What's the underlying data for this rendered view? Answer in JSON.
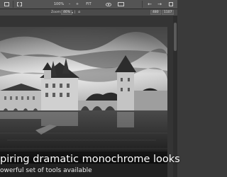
{
  "toolbar": {
    "icons": [
      "image-icon",
      "frame-icon",
      "zoom-out-icon",
      "zoom-in-icon",
      "fit-icon",
      "eye-icon",
      "compare-icon",
      "undo-icon",
      "redo-icon"
    ],
    "zoom_percent": "100%",
    "fit_label": "FIT"
  },
  "zoombar": {
    "zoom_label": "Zoom:",
    "zoom_value": "46%",
    "dims_w": "480",
    "dims_h": "1107"
  },
  "caption": {
    "title": "piring dramatic monochrome looks",
    "subtitle": "owerful set of tools available"
  }
}
